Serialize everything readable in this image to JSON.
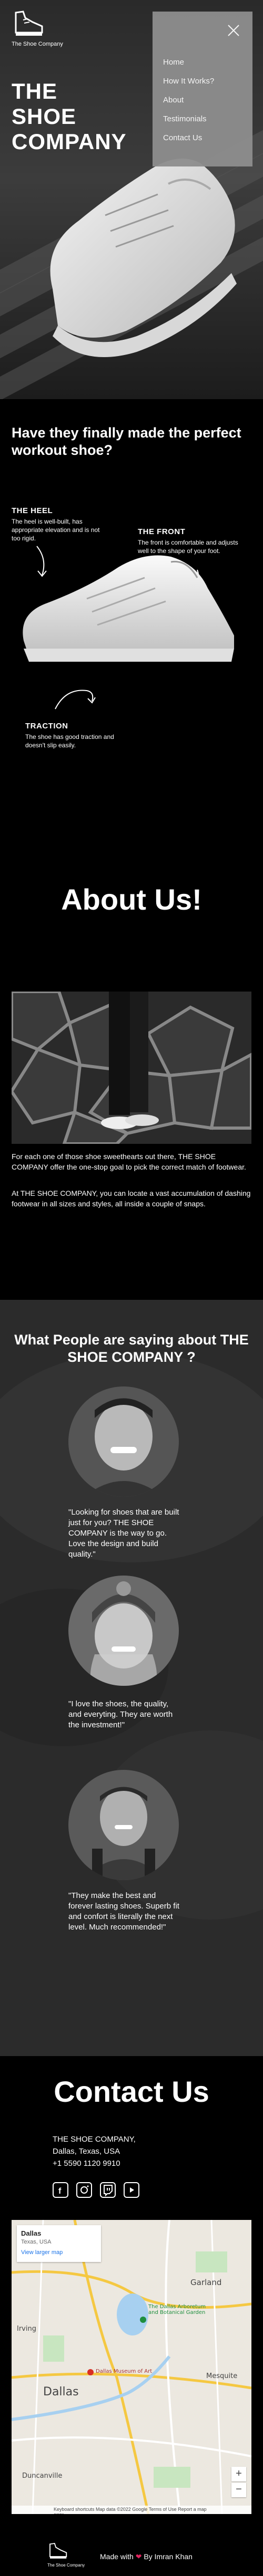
{
  "brand": {
    "logo_text": "The Shoe Company",
    "hero_title_line1": "THE",
    "hero_title_line2": "SHOE",
    "hero_title_line3": "COMPANY"
  },
  "nav": {
    "items": [
      {
        "label": "Home"
      },
      {
        "label": "How It Works?"
      },
      {
        "label": "About"
      },
      {
        "label": "Testimonials"
      },
      {
        "label": "Contact Us"
      }
    ]
  },
  "workout": {
    "title": "Have they finally made the perfect workout shoe?",
    "heel": {
      "title": "THE HEEL",
      "text": "The heel is well-built, has appropriate elevation and is not too rigid."
    },
    "front": {
      "title": "THE FRONT",
      "text": "The front is comfortable and adjusts well to the shape of your foot."
    },
    "traction": {
      "title": "TRACTION",
      "text": "The shoe has good traction and doesn't slip easily."
    }
  },
  "about": {
    "title": "About Us!",
    "p1": "For each one of those shoe sweethearts out there, THE SHOE COMPANY offer the one-stop goal to pick the correct match of footwear.",
    "p2": "At THE SHOE COMPANY, you can locate a vast accumulation of dashing footwear in all sizes and styles, all inside a couple of snaps."
  },
  "testimonials": {
    "title": "What People are saying about THE SHOE COMPANY ?",
    "items": [
      {
        "quote": "\"Looking for shoes that are built just for you? THE SHOE COMPANY is the way to go. Love the design and build quality.\""
      },
      {
        "quote": "\"I love the shoes, the quality, and everyting. They are worth the investment!\""
      },
      {
        "quote": "\"They make the best and forever lasting shoes. Superb fit and confort is literally the next level. Much recommended!\""
      }
    ]
  },
  "contact": {
    "title": "Contact Us",
    "company": "THE SHOE COMPANY,",
    "address": "Dallas, Texas, USA",
    "phone": "+1 5590 1120 9910",
    "socials": [
      {
        "icon": "facebook-icon"
      },
      {
        "icon": "instagram-icon"
      },
      {
        "icon": "twitch-icon"
      },
      {
        "icon": "youtube-icon"
      }
    ]
  },
  "map": {
    "card_title": "Dallas",
    "card_subtitle": "Texas, USA",
    "card_link": "View larger map",
    "labels": {
      "garland": "Garland",
      "dallas": "Dallas",
      "arboretum": "The Dallas Arboretum and Botanical Garden",
      "museum": "Dallas Museum of Art",
      "mesquite": "Mesquite",
      "irving": "Irving",
      "duncanville": "Duncanville"
    },
    "footer": "Keyboard shortcuts  Map data ©2022 Google  Terms of Use  Report a map error"
  },
  "footer": {
    "logo_text": "The Shoe Company",
    "made_with": "Made with",
    "by": "By Imran Khan"
  },
  "colors": {
    "accent_heart": "#e0245e",
    "nav_bg": "#8e8e8e",
    "link": "#1a73e8"
  }
}
